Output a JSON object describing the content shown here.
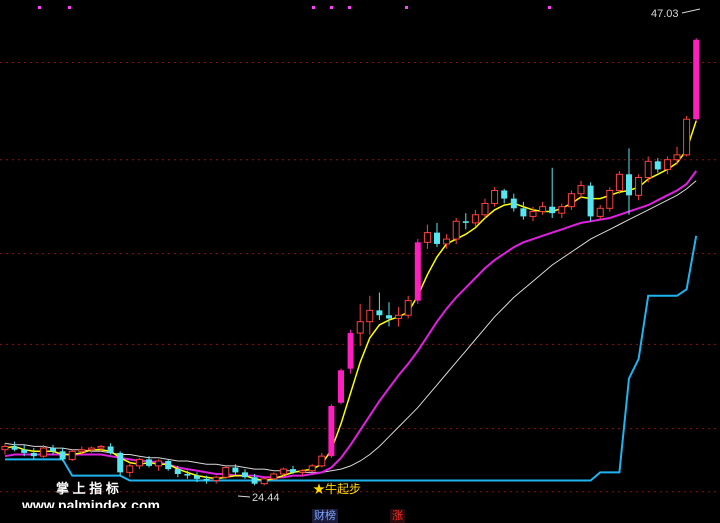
{
  "chart_data": {
    "type": "candlestick",
    "ylim": [
      18,
      48
    ],
    "hlines": [
      45.5,
      39.5,
      33.7,
      28.1,
      22.9,
      19.0
    ],
    "candles": [
      [
        21.6,
        22.0,
        21.3,
        21.8
      ],
      [
        21.8,
        22.1,
        21.5,
        21.6
      ],
      [
        21.6,
        21.9,
        21.2,
        21.4
      ],
      [
        21.4,
        21.7,
        21.0,
        21.2
      ],
      [
        21.2,
        21.9,
        21.1,
        21.7
      ],
      [
        21.7,
        21.9,
        21.3,
        21.5
      ],
      [
        21.5,
        21.7,
        20.9,
        21.0
      ],
      [
        21.0,
        21.6,
        20.9,
        21.5
      ],
      [
        21.5,
        21.8,
        21.3,
        21.6
      ],
      [
        21.6,
        21.8,
        21.4,
        21.7
      ],
      [
        21.7,
        21.9,
        21.5,
        21.8
      ],
      [
        21.8,
        22.0,
        21.3,
        21.4
      ],
      [
        21.4,
        21.5,
        20.0,
        20.2
      ],
      [
        20.2,
        20.8,
        19.9,
        20.6
      ],
      [
        20.6,
        21.1,
        20.4,
        21.0
      ],
      [
        21.0,
        21.2,
        20.5,
        20.6
      ],
      [
        20.6,
        21.0,
        20.3,
        20.9
      ],
      [
        20.9,
        21.0,
        20.3,
        20.4
      ],
      [
        20.4,
        20.6,
        19.9,
        20.1
      ],
      [
        20.1,
        20.3,
        19.8,
        20.0
      ],
      [
        20.0,
        20.2,
        19.6,
        19.8
      ],
      [
        19.8,
        20.0,
        19.5,
        19.7
      ],
      [
        19.7,
        20.0,
        19.5,
        19.9
      ],
      [
        19.9,
        20.6,
        19.8,
        20.5
      ],
      [
        20.5,
        20.7,
        20.0,
        20.2
      ],
      [
        20.2,
        20.4,
        19.8,
        19.9
      ],
      [
        19.9,
        20.1,
        19.4,
        19.5
      ],
      [
        19.5,
        19.9,
        19.4,
        19.8
      ],
      [
        19.8,
        20.2,
        19.7,
        20.1
      ],
      [
        20.1,
        20.5,
        20.0,
        20.4
      ],
      [
        20.4,
        20.6,
        20.1,
        20.2
      ],
      [
        20.2,
        20.4,
        20.0,
        20.3
      ],
      [
        20.3,
        20.7,
        20.2,
        20.6
      ],
      [
        20.6,
        21.4,
        20.5,
        21.2
      ],
      [
        21.2,
        24.4,
        21.1,
        24.3
      ],
      [
        24.5,
        26.6,
        24.4,
        26.5
      ],
      [
        26.6,
        29.0,
        26.3,
        28.8
      ],
      [
        28.8,
        30.6,
        28.0,
        29.5
      ],
      [
        29.5,
        31.1,
        28.7,
        30.2
      ],
      [
        30.2,
        31.3,
        29.6,
        29.9
      ],
      [
        29.9,
        30.7,
        29.2,
        29.7
      ],
      [
        29.7,
        30.4,
        29.2,
        29.9
      ],
      [
        29.9,
        31.1,
        29.7,
        30.8
      ],
      [
        30.8,
        34.6,
        30.6,
        34.4
      ],
      [
        34.4,
        35.5,
        34.0,
        35.0
      ],
      [
        35.0,
        35.6,
        34.1,
        34.3
      ],
      [
        34.3,
        34.9,
        34.0,
        34.6
      ],
      [
        34.6,
        35.9,
        34.3,
        35.7
      ],
      [
        35.7,
        36.2,
        35.2,
        35.6
      ],
      [
        35.6,
        36.4,
        35.4,
        36.1
      ],
      [
        36.1,
        37.1,
        35.9,
        36.8
      ],
      [
        36.8,
        37.8,
        36.6,
        37.6
      ],
      [
        37.6,
        37.7,
        36.8,
        37.1
      ],
      [
        37.1,
        37.4,
        36.3,
        36.5
      ],
      [
        36.5,
        36.9,
        35.8,
        36.0
      ],
      [
        36.0,
        36.6,
        35.7,
        36.3
      ],
      [
        36.3,
        36.9,
        36.1,
        36.6
      ],
      [
        36.6,
        39.0,
        35.9,
        36.2
      ],
      [
        36.2,
        36.8,
        35.9,
        36.6
      ],
      [
        36.6,
        37.6,
        36.4,
        37.4
      ],
      [
        37.4,
        38.2,
        37.1,
        37.9
      ],
      [
        37.9,
        38.1,
        35.7,
        36.0
      ],
      [
        36.0,
        36.7,
        35.8,
        36.5
      ],
      [
        36.5,
        37.8,
        36.3,
        37.6
      ],
      [
        37.6,
        38.8,
        37.4,
        38.6
      ],
      [
        38.6,
        40.2,
        36.1,
        37.3
      ],
      [
        37.3,
        38.6,
        37.0,
        38.4
      ],
      [
        38.4,
        39.7,
        38.1,
        39.4
      ],
      [
        39.4,
        39.6,
        38.7,
        38.9
      ],
      [
        38.9,
        39.7,
        38.6,
        39.5
      ],
      [
        39.5,
        40.3,
        39.2,
        39.8
      ],
      [
        39.8,
        42.2,
        39.7,
        42.0
      ],
      [
        42.0,
        47.0,
        41.9,
        46.9
      ]
    ],
    "ma_short": [
      21.7,
      21.8,
      21.6,
      21.5,
      21.5,
      21.5,
      21.3,
      21.3,
      21.4,
      21.6,
      21.6,
      21.5,
      21.1,
      20.8,
      20.7,
      20.8,
      20.7,
      20.7,
      20.4,
      20.2,
      20.0,
      19.9,
      19.8,
      19.9,
      20.0,
      20.0,
      19.8,
      19.7,
      19.8,
      20.0,
      20.2,
      20.3,
      20.4,
      20.7,
      21.6,
      23.2,
      25.1,
      27.0,
      28.5,
      29.3,
      29.6,
      29.8,
      30.1,
      31.1,
      32.4,
      33.5,
      34.3,
      34.6,
      34.9,
      35.3,
      35.9,
      36.4,
      36.7,
      36.8,
      36.6,
      36.4,
      36.3,
      36.3,
      36.5,
      36.8,
      37.2,
      37.1,
      37.1,
      37.3,
      37.5,
      37.6,
      37.8,
      38.3,
      38.6,
      38.9,
      39.3,
      40.1,
      41.9
    ],
    "ma_mid": [
      21.2,
      21.3,
      21.3,
      21.3,
      21.3,
      21.3,
      21.3,
      21.3,
      21.3,
      21.3,
      21.3,
      21.2,
      21.1,
      21.0,
      20.9,
      20.9,
      20.8,
      20.7,
      20.5,
      20.4,
      20.3,
      20.2,
      20.1,
      20.1,
      20.0,
      20.0,
      20.0,
      19.9,
      19.9,
      19.9,
      20.0,
      20.0,
      20.1,
      20.2,
      20.5,
      21.1,
      21.9,
      22.8,
      23.7,
      24.6,
      25.4,
      26.2,
      26.9,
      27.7,
      28.6,
      29.5,
      30.3,
      31.0,
      31.6,
      32.2,
      32.8,
      33.3,
      33.7,
      34.1,
      34.4,
      34.6,
      34.8,
      35.0,
      35.2,
      35.4,
      35.6,
      35.7,
      35.8,
      35.9,
      36.1,
      36.3,
      36.5,
      36.7,
      37.0,
      37.3,
      37.6,
      38.0,
      38.8
    ],
    "ma_long": [
      22.0,
      21.9,
      21.9,
      21.8,
      21.8,
      21.7,
      21.7,
      21.6,
      21.6,
      21.5,
      21.5,
      21.4,
      21.3,
      21.3,
      21.2,
      21.1,
      21.1,
      21.0,
      20.9,
      20.9,
      20.8,
      20.7,
      20.7,
      20.6,
      20.6,
      20.5,
      20.4,
      20.4,
      20.3,
      20.3,
      20.3,
      20.2,
      20.2,
      20.2,
      20.3,
      20.4,
      20.6,
      20.9,
      21.3,
      21.8,
      22.4,
      23.0,
      23.6,
      24.2,
      24.9,
      25.6,
      26.3,
      27.0,
      27.7,
      28.4,
      29.1,
      29.8,
      30.4,
      31.0,
      31.5,
      32.0,
      32.5,
      33.0,
      33.4,
      33.8,
      34.2,
      34.6,
      34.9,
      35.2,
      35.5,
      35.8,
      36.1,
      36.4,
      36.7,
      37.0,
      37.3,
      37.7,
      38.2
    ],
    "support_line": [
      21.0,
      21.0,
      21.0,
      21.0,
      21.0,
      21.0,
      21.0,
      20.0,
      20.0,
      20.0,
      20.0,
      20.0,
      20.0,
      19.7,
      19.7,
      19.7,
      19.7,
      19.7,
      19.7,
      19.7,
      19.7,
      19.7,
      19.7,
      19.7,
      19.7,
      19.7,
      19.7,
      19.7,
      19.7,
      19.7,
      19.7,
      19.7,
      19.7,
      19.7,
      19.7,
      19.7,
      19.7,
      19.7,
      19.7,
      19.7,
      19.7,
      19.7,
      19.7,
      19.7,
      19.7,
      19.7,
      19.7,
      19.7,
      19.7,
      19.7,
      19.7,
      19.7,
      19.7,
      19.7,
      19.7,
      19.7,
      19.7,
      19.7,
      19.7,
      19.7,
      19.7,
      19.7,
      20.2,
      20.2,
      20.2,
      26.0,
      27.2,
      31.1,
      31.1,
      31.1,
      31.1,
      31.5,
      34.8
    ],
    "annotations": {
      "high_label": "47.03",
      "low_label": "24.44",
      "signal_label": "★牛起步",
      "watermark_cn": "掌 上 指 标",
      "watermark_url": "www.palmindex.com"
    },
    "bottom_tags": [
      "财榜",
      "涨"
    ],
    "colors": {
      "background": "#000000",
      "grid": "#8b1010",
      "up": "#ff4040",
      "down": "#55e6f0",
      "limit_up": "#ff1fbf",
      "ma_short": "#ffff00",
      "ma_mid": "#e020e0",
      "ma_long": "#d8d8d8",
      "support": "#1fb4f0"
    }
  }
}
